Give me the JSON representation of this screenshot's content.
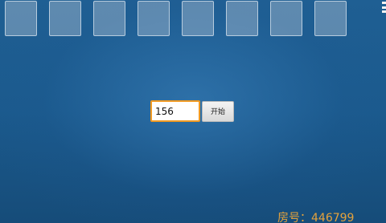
{
  "slots": [
    {
      "id": "slot-1"
    },
    {
      "id": "slot-2"
    },
    {
      "id": "slot-3"
    },
    {
      "id": "slot-4"
    },
    {
      "id": "slot-5"
    },
    {
      "id": "slot-6"
    },
    {
      "id": "slot-7"
    },
    {
      "id": "slot-8"
    }
  ],
  "menu": {
    "icon": "menu-icon"
  },
  "entry": {
    "value": "156",
    "start_label": "开始"
  },
  "room": {
    "label": "房号：446799"
  },
  "colors": {
    "input_border": "#f19a22",
    "room_text": "#e4a23c",
    "background": "#1b5a8d"
  }
}
